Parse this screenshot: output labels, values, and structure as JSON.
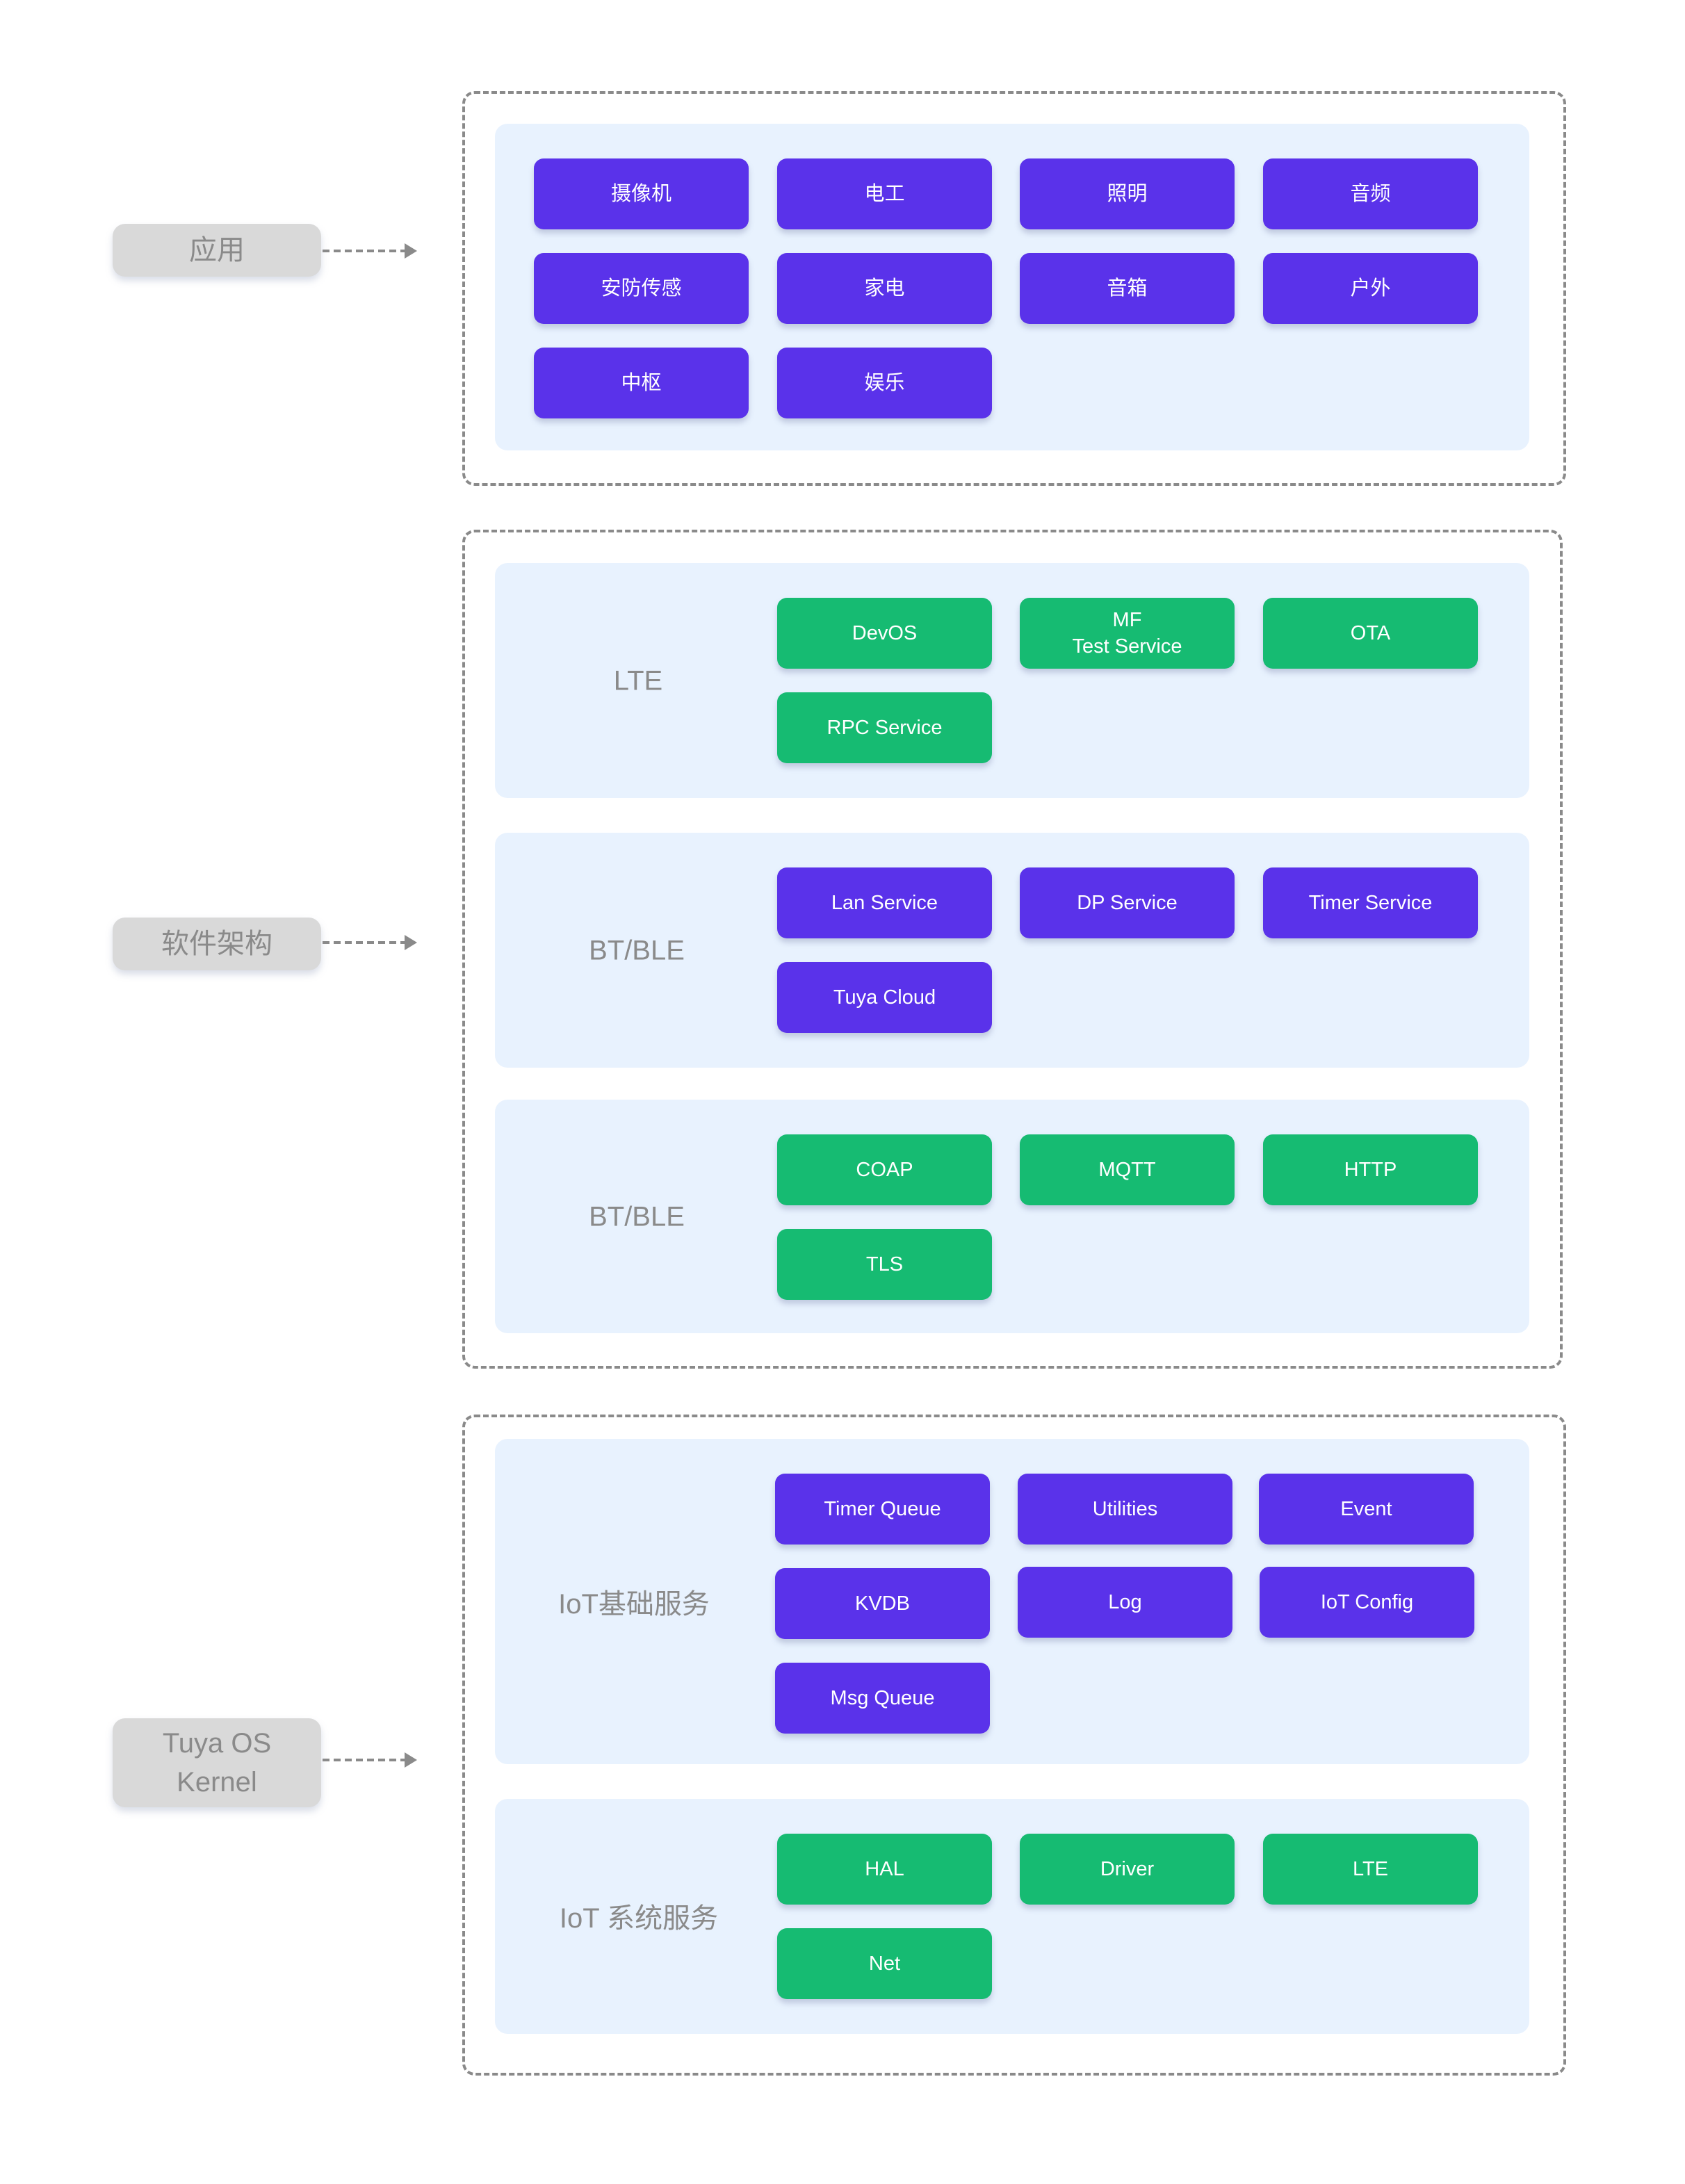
{
  "colors": {
    "purple_module": "#5a32ea",
    "green_module": "#16bb72",
    "panel_bg": "#e8f2fe",
    "label_bg": "#d9d9d9",
    "label_text": "#8a8a8a",
    "dashed_border": "#8a8a8a"
  },
  "tiers": [
    {
      "label": "应用",
      "sections": [
        {
          "label": "",
          "modules": [
            {
              "text": "摄像机",
              "color": "purple"
            },
            {
              "text": "电工",
              "color": "purple"
            },
            {
              "text": "照明",
              "color": "purple"
            },
            {
              "text": "音频",
              "color": "purple"
            },
            {
              "text": "安防传感",
              "color": "purple"
            },
            {
              "text": "家电",
              "color": "purple"
            },
            {
              "text": "音箱",
              "color": "purple"
            },
            {
              "text": "户外",
              "color": "purple"
            },
            {
              "text": "中枢",
              "color": "purple"
            },
            {
              "text": "娱乐",
              "color": "purple"
            }
          ]
        }
      ]
    },
    {
      "label": "软件架构",
      "sections": [
        {
          "label": "LTE",
          "modules": [
            {
              "text": "DevOS",
              "color": "green"
            },
            {
              "text": "MF\nTest Service",
              "color": "green"
            },
            {
              "text": "OTA",
              "color": "green"
            },
            {
              "text": "RPC Service",
              "color": "green"
            }
          ]
        },
        {
          "label": "BT/BLE",
          "modules": [
            {
              "text": "Lan Service",
              "color": "purple"
            },
            {
              "text": "DP Service",
              "color": "purple"
            },
            {
              "text": "Timer Service",
              "color": "purple"
            },
            {
              "text": "Tuya Cloud",
              "color": "purple"
            }
          ]
        },
        {
          "label": "BT/BLE",
          "modules": [
            {
              "text": "COAP",
              "color": "green"
            },
            {
              "text": "MQTT",
              "color": "green"
            },
            {
              "text": "HTTP",
              "color": "green"
            },
            {
              "text": "TLS",
              "color": "green"
            }
          ]
        }
      ]
    },
    {
      "label": "Tuya OS\nKernel",
      "sections": [
        {
          "label": "IoT基础服务",
          "modules": [
            {
              "text": "Timer Queue",
              "color": "purple"
            },
            {
              "text": "Utilities",
              "color": "purple"
            },
            {
              "text": "Event",
              "color": "purple"
            },
            {
              "text": "KVDB",
              "color": "purple"
            },
            {
              "text": "Log",
              "color": "purple"
            },
            {
              "text": "IoT Config",
              "color": "purple"
            },
            {
              "text": "Msg Queue",
              "color": "purple"
            }
          ]
        },
        {
          "label": "IoT 系统服务",
          "modules": [
            {
              "text": "HAL",
              "color": "green"
            },
            {
              "text": "Driver",
              "color": "green"
            },
            {
              "text": "LTE",
              "color": "green"
            },
            {
              "text": "Net",
              "color": "green"
            }
          ]
        }
      ]
    }
  ]
}
